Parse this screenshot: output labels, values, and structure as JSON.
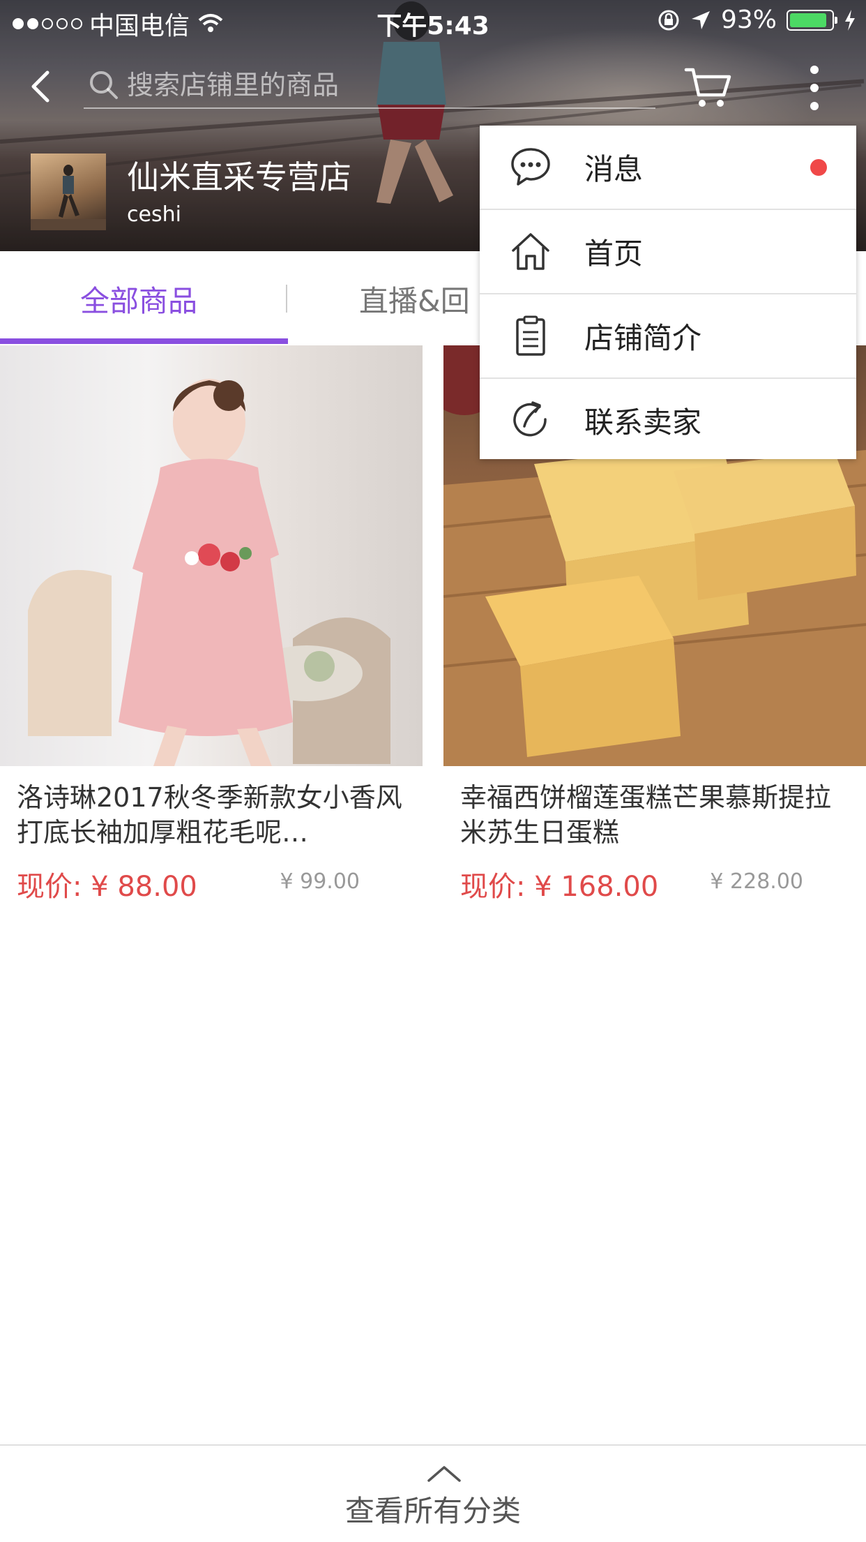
{
  "status_bar": {
    "carrier": "中国电信",
    "time": "下午5:43",
    "battery": "93%",
    "battery_level": 0.93,
    "signal_filled": 2,
    "signal_total": 5
  },
  "nav": {
    "search_placeholder": "搜索店铺里的商品",
    "icons": [
      "back-icon",
      "search-icon",
      "cart-icon",
      "more-icon"
    ]
  },
  "shop": {
    "name": "仙米直采专营店",
    "subtitle": "ceshi"
  },
  "tabs": [
    {
      "label": "全部商品",
      "active": true
    },
    {
      "label": "直播&回",
      "active": false
    }
  ],
  "products": [
    {
      "title": "洛诗琳2017秋冬季新款女小香风打底长袖加厚粗花毛呢…",
      "price": "现价: ¥ 88.00",
      "original_price": "¥ 99.00"
    },
    {
      "title": "幸福西饼榴莲蛋糕芒果慕斯提拉米苏生日蛋糕",
      "price": "现价: ¥ 168.00",
      "original_price": "¥ 228.00"
    }
  ],
  "menu": {
    "items": [
      {
        "label": "消息",
        "icon": "chat-bubble-icon",
        "has_dot": true
      },
      {
        "label": "首页",
        "icon": "home-icon",
        "has_dot": false
      },
      {
        "label": "店铺简介",
        "icon": "clipboard-icon",
        "has_dot": false
      },
      {
        "label": "联系卖家",
        "icon": "share-arrow-icon",
        "has_dot": false
      }
    ]
  },
  "footer": {
    "label": "查看所有分类"
  },
  "colors": {
    "accent": "#8a4fe0",
    "price": "#e04a4a",
    "badge": "#f04848",
    "battery": "#4cd964"
  }
}
